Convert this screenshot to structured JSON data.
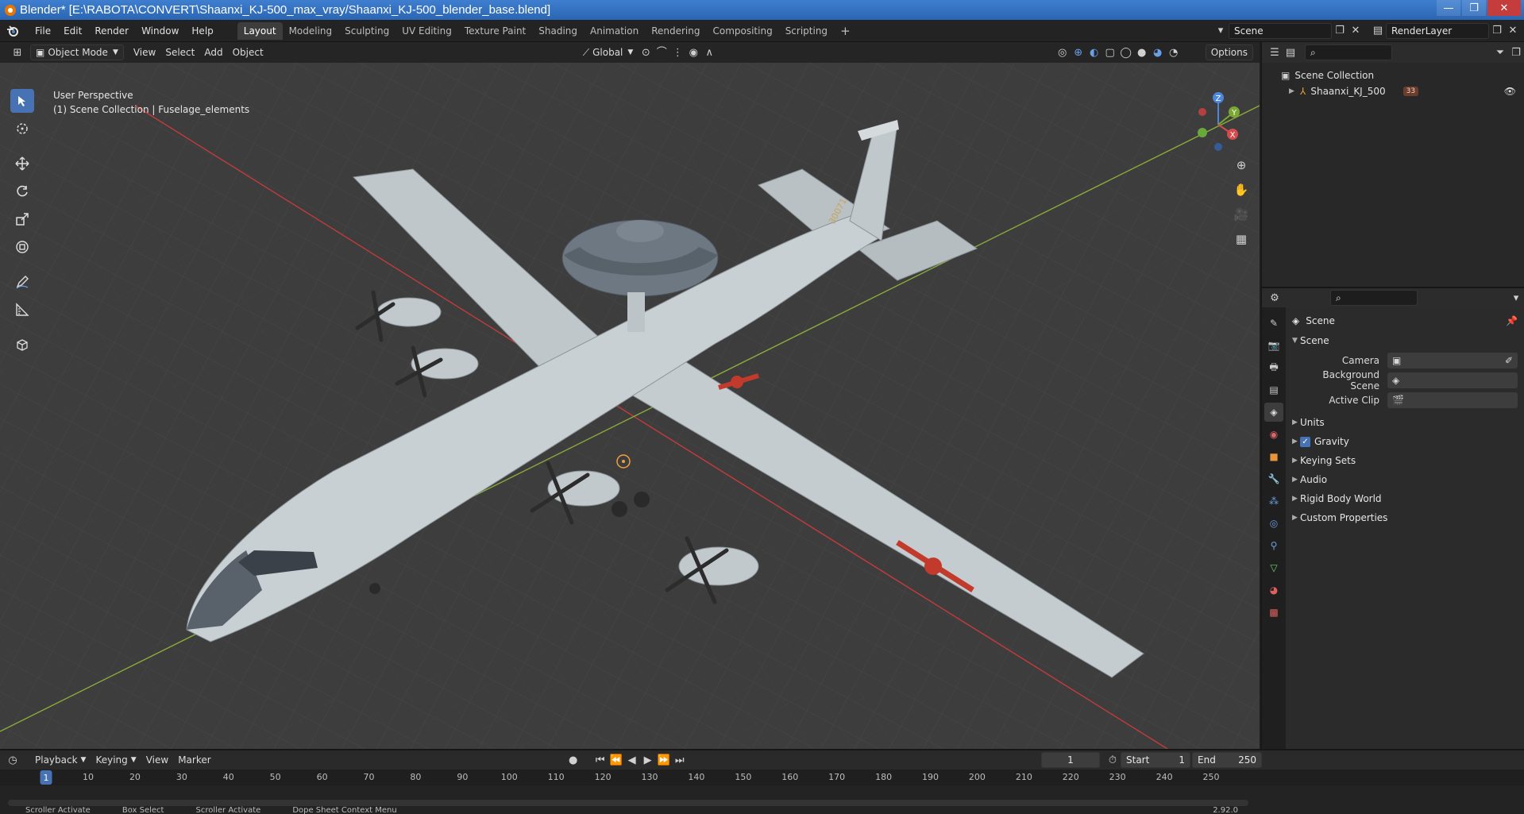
{
  "window": {
    "title": "Blender* [E:\\RABOTA\\CONVERT\\Shaanxi_KJ-500_max_vray/Shaanxi_KJ-500_blender_base.blend]",
    "buttons": [
      "—",
      "❐",
      "✕"
    ]
  },
  "menu": [
    "File",
    "Edit",
    "Render",
    "Window",
    "Help"
  ],
  "workspaces": [
    {
      "label": "Layout",
      "active": true
    },
    {
      "label": "Modeling"
    },
    {
      "label": "Sculpting"
    },
    {
      "label": "UV Editing"
    },
    {
      "label": "Texture Paint"
    },
    {
      "label": "Shading"
    },
    {
      "label": "Animation"
    },
    {
      "label": "Rendering"
    },
    {
      "label": "Compositing"
    },
    {
      "label": "Scripting"
    }
  ],
  "add_workspace": "+",
  "scene_selector": "Scene",
  "layer_selector": "RenderLayer",
  "viewport": {
    "mode": "Object Mode",
    "menus": [
      "View",
      "Select",
      "Add",
      "Object"
    ],
    "transform_orientation": "Global",
    "options": "Options",
    "info_line1": "User Perspective",
    "info_line2": "(1) Scene Collection | Fuselage_elements",
    "gizmo_axes": {
      "x": "X",
      "y": "Y",
      "z": "Z"
    },
    "tail_number": "30071"
  },
  "outliner": {
    "root": "Scene Collection",
    "items": [
      {
        "name": "Shaanxi_KJ_500",
        "badge": "33"
      }
    ]
  },
  "properties": {
    "context": "Scene",
    "panel_open": "Scene",
    "fields": [
      {
        "label": "Camera",
        "value": ""
      },
      {
        "label": "Background Scene",
        "value": ""
      },
      {
        "label": "Active Clip",
        "value": ""
      }
    ],
    "panels": [
      "Units",
      "Gravity",
      "Keying Sets",
      "Audio",
      "Rigid Body World",
      "Custom Properties"
    ],
    "gravity_checked": true
  },
  "timeline": {
    "menus": [
      "Playback",
      "Keying",
      "View",
      "Marker"
    ],
    "current_frame": "1",
    "start_label": "Start",
    "start": "1",
    "end_label": "End",
    "end": "250",
    "ruler": [
      1,
      10,
      20,
      30,
      40,
      50,
      60,
      70,
      80,
      90,
      100,
      110,
      120,
      130,
      140,
      150,
      160,
      170,
      180,
      190,
      200,
      210,
      220,
      230,
      240,
      250
    ]
  },
  "status": {
    "items": [
      "Scroller Activate",
      "Box Select",
      "Scroller Activate",
      "Dope Sheet Context Menu"
    ],
    "version": "2.92.0"
  }
}
